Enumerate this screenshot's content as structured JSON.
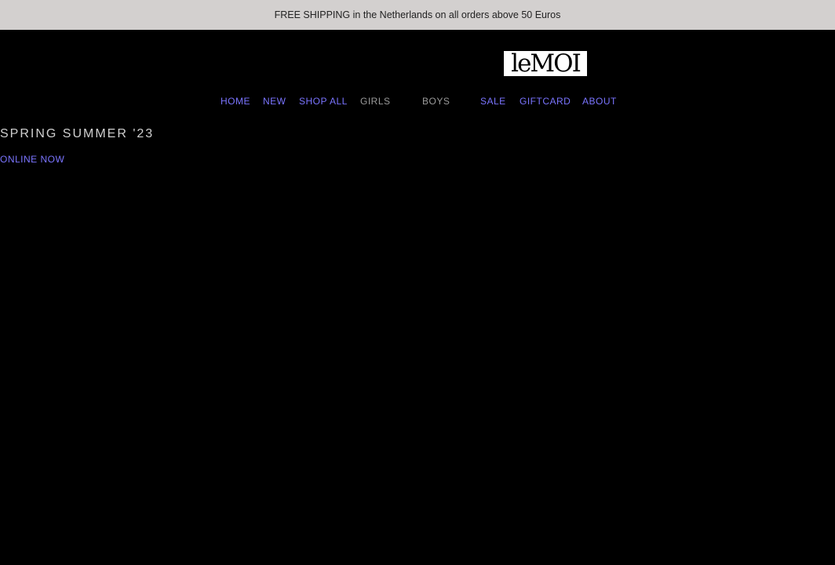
{
  "announcement": {
    "text": "FREE SHIPPING in the Netherlands on all orders above 50 Euros"
  },
  "brand": {
    "logo_text": "leMOI"
  },
  "nav": {
    "items": [
      {
        "label": "HOME"
      },
      {
        "label": "NEW"
      },
      {
        "label": "SHOP ALL"
      },
      {
        "label": "GIRLS"
      },
      {
        "label": "BOYS"
      },
      {
        "label": "SALE"
      },
      {
        "label": "GIFTCARD"
      },
      {
        "label": "ABOUT"
      }
    ]
  },
  "hero": {
    "title": "SPRING SUMMER '23",
    "cta": "ONLINE NOW"
  },
  "colors": {
    "link": "#7a74ff",
    "muted_link": "#9a9a9a",
    "banner_bg": "#d3d0cf",
    "page_bg": "#000000"
  }
}
